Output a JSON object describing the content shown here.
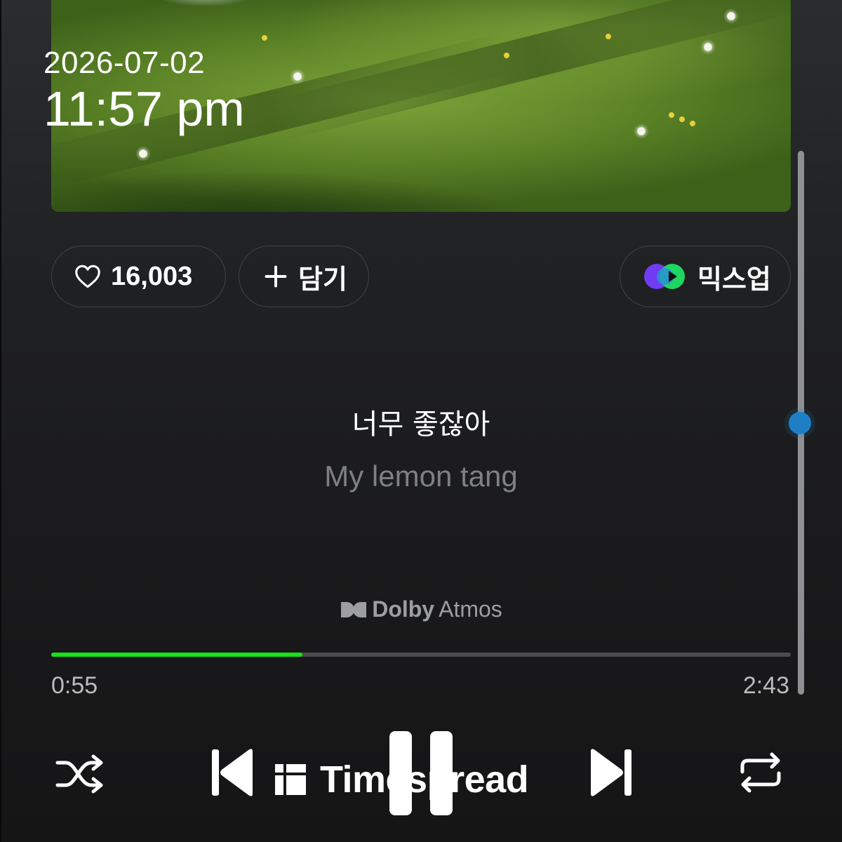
{
  "status": {
    "date": "2026-07-02",
    "time": "11:57 pm"
  },
  "actions": {
    "like_count": "16,003",
    "add_label": "담기",
    "mixup_label": "믹스업"
  },
  "lyrics": {
    "current": "너무 좋잖아",
    "next": "My lemon tang"
  },
  "badge": {
    "brand": "Dolby",
    "product": "Atmos"
  },
  "player": {
    "elapsed": "0:55",
    "total": "2:43",
    "progress_fraction": 0.34,
    "state": "playing"
  },
  "watermark": {
    "text": "Timespread"
  },
  "colors": {
    "progress": "#13e316",
    "scroll_thumb": "#1f7fc4",
    "mixup_purple": "#6f3cf2",
    "mixup_green": "#1ed760"
  },
  "icons": {
    "like": "heart-icon",
    "add": "plus-icon",
    "mixup": "mixup-logo-icon",
    "shuffle": "shuffle-icon",
    "prev": "skip-previous-icon",
    "pause": "pause-icon",
    "next": "skip-next-icon",
    "repeat": "repeat-icon"
  }
}
